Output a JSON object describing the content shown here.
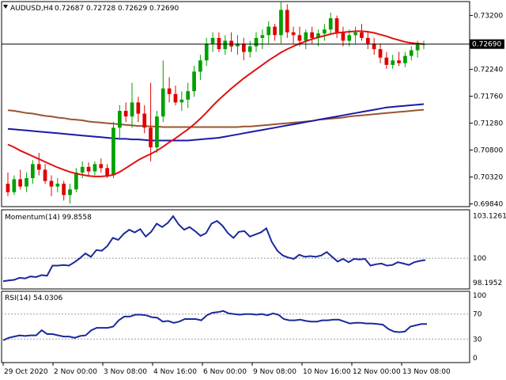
{
  "colors": {
    "background": "#ffffff",
    "bull": "#00a000",
    "bear": "#e00000",
    "ma_fast": "#e01010",
    "ma_mid": "#1a1aa8",
    "ma_slow": "#9a5530",
    "indicator": "#1a2a9a",
    "frame": "#000000",
    "grid": "#9a9a9a",
    "price_tag_bg": "#000000",
    "price_tag_fg": "#ffffff"
  },
  "header": {
    "symbol": "AUDUSD,H4",
    "open": "0.72687",
    "high": "0.72728",
    "low": "0.72629",
    "close": "0.72690"
  },
  "current_price_label": "0.72690",
  "chart_data": [
    {
      "type": "candlestick",
      "title": "AUDUSD,H4",
      "y_tick_labels": [
        "0.73200",
        "0.72240",
        "0.71760",
        "0.71280",
        "0.70800",
        "0.70320",
        "0.69840"
      ],
      "ylim": [
        0.6982,
        0.7342
      ],
      "current_price": 0.7269,
      "x_tick_labels": [
        "29 Oct 2020",
        "2 Nov 00:00",
        "3 Nov 08:00",
        "4 Nov 16:00",
        "6 Nov 00:00",
        "9 Nov 08:00",
        "10 Nov 16:00",
        "12 Nov 00:00",
        "13 Nov 08:00"
      ],
      "ohlc": [
        [
          0.702,
          0.704,
          0.6998,
          0.7005
        ],
        [
          0.7005,
          0.7035,
          0.7,
          0.7028
        ],
        [
          0.7028,
          0.7045,
          0.701,
          0.7015
        ],
        [
          0.7015,
          0.704,
          0.7005,
          0.703
        ],
        [
          0.703,
          0.7062,
          0.702,
          0.7055
        ],
        [
          0.7055,
          0.7075,
          0.7035,
          0.7045
        ],
        [
          0.7045,
          0.7055,
          0.702,
          0.7025
        ],
        [
          0.7025,
          0.7035,
          0.6998,
          0.7015
        ],
        [
          0.7015,
          0.703,
          0.7005,
          0.702
        ],
        [
          0.702,
          0.7025,
          0.699,
          0.7
        ],
        [
          0.7,
          0.702,
          0.6985,
          0.701
        ],
        [
          0.701,
          0.7048,
          0.7005,
          0.704
        ],
        [
          0.704,
          0.706,
          0.703,
          0.705
        ],
        [
          0.705,
          0.7058,
          0.7035,
          0.7042
        ],
        [
          0.7042,
          0.706,
          0.7035,
          0.7055
        ],
        [
          0.7055,
          0.7065,
          0.704,
          0.7048
        ],
        [
          0.7048,
          0.7055,
          0.703,
          0.7035
        ],
        [
          0.7035,
          0.713,
          0.703,
          0.712
        ],
        [
          0.712,
          0.716,
          0.71,
          0.715
        ],
        [
          0.715,
          0.7165,
          0.713,
          0.714
        ],
        [
          0.714,
          0.72,
          0.712,
          0.7165
        ],
        [
          0.7165,
          0.7175,
          0.713,
          0.7145
        ],
        [
          0.7145,
          0.716,
          0.711,
          0.712
        ],
        [
          0.712,
          0.72,
          0.706,
          0.7085
        ],
        [
          0.7085,
          0.715,
          0.7075,
          0.714
        ],
        [
          0.714,
          0.724,
          0.713,
          0.719
        ],
        [
          0.719,
          0.721,
          0.7165,
          0.718
        ],
        [
          0.718,
          0.7195,
          0.716,
          0.7165
        ],
        [
          0.7165,
          0.7185,
          0.715,
          0.717
        ],
        [
          0.717,
          0.72,
          0.7155,
          0.7185
        ],
        [
          0.7185,
          0.723,
          0.7175,
          0.722
        ],
        [
          0.722,
          0.725,
          0.7205,
          0.724
        ],
        [
          0.724,
          0.728,
          0.723,
          0.727
        ],
        [
          0.727,
          0.729,
          0.7255,
          0.728
        ],
        [
          0.728,
          0.729,
          0.7255,
          0.726
        ],
        [
          0.726,
          0.7285,
          0.725,
          0.7275
        ],
        [
          0.7275,
          0.729,
          0.7255,
          0.7265
        ],
        [
          0.7265,
          0.7285,
          0.725,
          0.727
        ],
        [
          0.727,
          0.728,
          0.724,
          0.7255
        ],
        [
          0.7255,
          0.7275,
          0.7245,
          0.7265
        ],
        [
          0.7265,
          0.729,
          0.7255,
          0.728
        ],
        [
          0.728,
          0.7295,
          0.726,
          0.7285
        ],
        [
          0.7285,
          0.731,
          0.727,
          0.73
        ],
        [
          0.73,
          0.7305,
          0.7275,
          0.7285
        ],
        [
          0.7285,
          0.7345,
          0.727,
          0.733
        ],
        [
          0.733,
          0.734,
          0.728,
          0.729
        ],
        [
          0.729,
          0.73,
          0.727,
          0.7285
        ],
        [
          0.7285,
          0.73,
          0.7265,
          0.7275
        ],
        [
          0.7275,
          0.7295,
          0.726,
          0.729
        ],
        [
          0.729,
          0.73,
          0.727,
          0.728
        ],
        [
          0.728,
          0.7295,
          0.7265,
          0.7288
        ],
        [
          0.7288,
          0.7305,
          0.7275,
          0.7295
        ],
        [
          0.7295,
          0.7325,
          0.7285,
          0.7315
        ],
        [
          0.7315,
          0.732,
          0.728,
          0.729
        ],
        [
          0.729,
          0.73,
          0.7265,
          0.7275
        ],
        [
          0.7275,
          0.7295,
          0.7265,
          0.7285
        ],
        [
          0.7285,
          0.73,
          0.727,
          0.729
        ],
        [
          0.729,
          0.7305,
          0.7275,
          0.728
        ],
        [
          0.728,
          0.729,
          0.726,
          0.727
        ],
        [
          0.727,
          0.728,
          0.725,
          0.726
        ],
        [
          0.726,
          0.727,
          0.7235,
          0.7245
        ],
        [
          0.7245,
          0.7255,
          0.7225,
          0.7232
        ],
        [
          0.7232,
          0.725,
          0.7225,
          0.724
        ],
        [
          0.724,
          0.7255,
          0.723,
          0.7235
        ],
        [
          0.7235,
          0.7255,
          0.7228,
          0.7248
        ],
        [
          0.7248,
          0.7265,
          0.724,
          0.7258
        ],
        [
          0.7258,
          0.7275,
          0.7245,
          0.7268
        ],
        [
          0.7268,
          0.7275,
          0.726,
          0.7269
        ]
      ],
      "ma_fast": [
        0.709,
        0.7085,
        0.7079,
        0.7074,
        0.7069,
        0.7064,
        0.7059,
        0.7054,
        0.7049,
        0.7045,
        0.7041,
        0.7038,
        0.7036,
        0.7034,
        0.7033,
        0.7033,
        0.7034,
        0.7036,
        0.7041,
        0.7048,
        0.7055,
        0.7062,
        0.7068,
        0.7073,
        0.7079,
        0.7086,
        0.7094,
        0.7101,
        0.7109,
        0.7117,
        0.7126,
        0.7136,
        0.7147,
        0.7159,
        0.717,
        0.718,
        0.719,
        0.7199,
        0.7208,
        0.7216,
        0.7224,
        0.7232,
        0.724,
        0.7247,
        0.7254,
        0.726,
        0.7265,
        0.727,
        0.7274,
        0.7278,
        0.7281,
        0.7284,
        0.7287,
        0.7289,
        0.729,
        0.7291,
        0.7292,
        0.7292,
        0.7291,
        0.7289,
        0.7286,
        0.7283,
        0.7279,
        0.7276,
        0.7273,
        0.7271,
        0.727,
        0.7269
      ],
      "ma_mid": [
        0.7118,
        0.7117,
        0.7116,
        0.7115,
        0.7114,
        0.7113,
        0.7112,
        0.7111,
        0.711,
        0.7109,
        0.7108,
        0.7107,
        0.7106,
        0.7105,
        0.7104,
        0.7103,
        0.7102,
        0.7101,
        0.71,
        0.71,
        0.7099,
        0.7099,
        0.7098,
        0.7097,
        0.7097,
        0.7097,
        0.7097,
        0.7097,
        0.7097,
        0.7097,
        0.7098,
        0.7099,
        0.71,
        0.7101,
        0.7102,
        0.7104,
        0.7106,
        0.7108,
        0.711,
        0.7112,
        0.7114,
        0.7116,
        0.7118,
        0.712,
        0.7122,
        0.7124,
        0.7126,
        0.7128,
        0.713,
        0.7132,
        0.7134,
        0.7136,
        0.7138,
        0.714,
        0.7142,
        0.7144,
        0.7146,
        0.7148,
        0.715,
        0.7152,
        0.7154,
        0.7156,
        0.7157,
        0.7158,
        0.7159,
        0.716,
        0.7161,
        0.7162
      ],
      "ma_slow": [
        0.7151,
        0.715,
        0.7148,
        0.7146,
        0.7145,
        0.7143,
        0.7141,
        0.714,
        0.7138,
        0.7137,
        0.7135,
        0.7134,
        0.7133,
        0.7131,
        0.713,
        0.7129,
        0.7128,
        0.7127,
        0.7126,
        0.7125,
        0.7124,
        0.7123,
        0.7123,
        0.7122,
        0.7122,
        0.7121,
        0.7121,
        0.7121,
        0.7121,
        0.7121,
        0.7121,
        0.7121,
        0.7121,
        0.7121,
        0.7121,
        0.7121,
        0.7121,
        0.7121,
        0.7122,
        0.7122,
        0.7123,
        0.7124,
        0.7125,
        0.7126,
        0.7127,
        0.7128,
        0.7129,
        0.713,
        0.7131,
        0.7132,
        0.7134,
        0.7135,
        0.7136,
        0.7137,
        0.7138,
        0.714,
        0.7141,
        0.7142,
        0.7143,
        0.7144,
        0.7145,
        0.7146,
        0.7147,
        0.7148,
        0.7149,
        0.715,
        0.7151,
        0.7152
      ]
    },
    {
      "type": "line",
      "title": "Momentum(14) 99.8558",
      "y_tick_labels": [
        "103.1261",
        "100",
        "98.1952"
      ],
      "ylim": [
        97.9,
        103.4
      ],
      "levels": [
        100
      ],
      "values": [
        98.3,
        98.35,
        98.4,
        98.55,
        98.5,
        98.65,
        98.6,
        98.75,
        98.7,
        99.45,
        99.45,
        99.5,
        99.45,
        99.7,
        100.0,
        100.35,
        100.1,
        100.6,
        100.55,
        100.9,
        101.5,
        101.35,
        101.8,
        102.1,
        101.9,
        102.15,
        101.6,
        101.95,
        102.55,
        102.3,
        102.6,
        103.1,
        102.5,
        102.1,
        102.3,
        102.0,
        101.65,
        101.85,
        102.55,
        102.75,
        102.4,
        101.85,
        101.5,
        101.95,
        102.0,
        101.6,
        101.75,
        101.9,
        102.2,
        101.2,
        100.55,
        100.2,
        100.05,
        99.95,
        100.25,
        100.1,
        100.15,
        100.1,
        100.2,
        100.45,
        100.1,
        99.75,
        99.95,
        99.7,
        99.95,
        99.9,
        99.95,
        99.45,
        99.55,
        99.6,
        99.45,
        99.5,
        99.7,
        99.6,
        99.5,
        99.7,
        99.8,
        99.86
      ]
    },
    {
      "type": "line",
      "title": "RSI(14) 54.0306",
      "y_tick_labels": [
        "100",
        "70",
        "30",
        "0"
      ],
      "ylim": [
        0,
        100
      ],
      "levels": [
        70,
        30
      ],
      "values": [
        28,
        32,
        34,
        36,
        35,
        36,
        36,
        44,
        38,
        38,
        36,
        34,
        34,
        32,
        35,
        36,
        44,
        48,
        48,
        48,
        50,
        60,
        66,
        66,
        69,
        69,
        68,
        65,
        64,
        58,
        59,
        56,
        58,
        62,
        62,
        62,
        60,
        68,
        72,
        73,
        75,
        71,
        70,
        69,
        70,
        70,
        69,
        70,
        68,
        71,
        69,
        62,
        60,
        60,
        61,
        59,
        58,
        58,
        60,
        60,
        61,
        61,
        58,
        55,
        56,
        56,
        55,
        55,
        54,
        53,
        46,
        42,
        41,
        42,
        50,
        52,
        54,
        54
      ]
    }
  ]
}
